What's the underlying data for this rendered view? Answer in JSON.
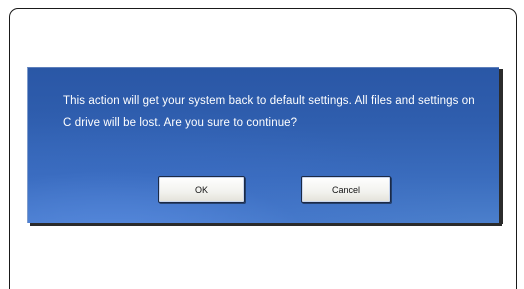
{
  "dialog": {
    "message": "This action will get your system back to default settings. All files and settings on C drive will be lost. Are you sure to continue?",
    "buttons": {
      "ok_label": "OK",
      "cancel_label": "Cancel"
    }
  },
  "colors": {
    "dialog_background": "#3366b3",
    "text": "#ffffff",
    "button_face": "#f2f2ee"
  }
}
